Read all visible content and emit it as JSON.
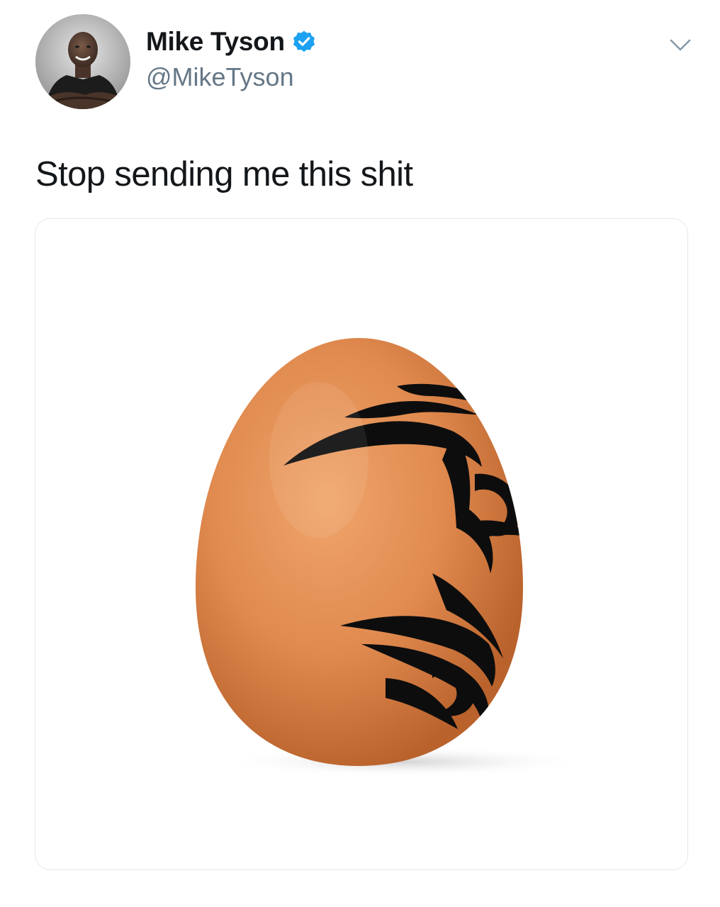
{
  "tweet": {
    "author": {
      "display_name": "Mike Tyson",
      "handle": "@MikeTyson",
      "verified": true,
      "avatar_icon": "profile-photo-icon"
    },
    "text": "Stop sending me this shit",
    "menu_icon": "chevron-down-icon",
    "media": {
      "type": "photo",
      "description_icon": "egg-icon"
    }
  },
  "colors": {
    "name": "#14171a",
    "handle": "#657786",
    "verified_badge": "#1da1f2",
    "caret": "#8899a6",
    "border": "#e1e8ed",
    "egg": "#e08a4f",
    "tattoo": "#0d0d0d"
  }
}
